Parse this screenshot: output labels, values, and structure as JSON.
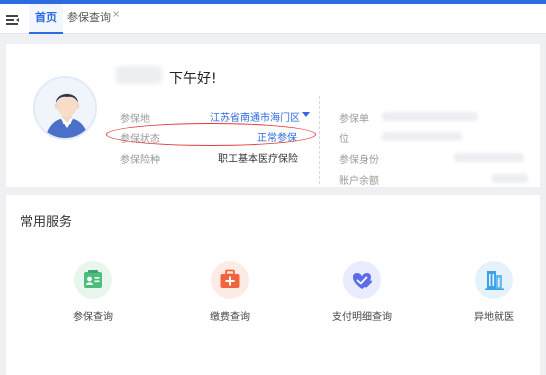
{
  "tabs": {
    "home": "首页",
    "insurance_query": "参保查询",
    "close_glyph": "×"
  },
  "profile": {
    "greeting": "下午好!",
    "insured_place_label": "参保地",
    "insured_place_value": "江苏省南通市海门区",
    "insured_status_label": "参保状态",
    "insured_status_value": "正常参保",
    "insurance_type_label": "参保险种",
    "insurance_type_value": "职工基本医疗保险",
    "insured_unit_label": "参保单",
    "position_label": "位",
    "insured_identity_label": "参保身份",
    "account_balance_label": "账户余额"
  },
  "services": {
    "title": "常用服务",
    "items": [
      {
        "label": "参保查询",
        "icon": "id-card-icon",
        "color": "#4cbd7b",
        "bg": "#e8f6ee"
      },
      {
        "label": "缴费查询",
        "icon": "medical-kit-icon",
        "color": "#f0643e",
        "bg": "#fdece6"
      },
      {
        "label": "支付明细查询",
        "icon": "heart-check-icon",
        "color": "#5b6ee8",
        "bg": "#e9ecfc"
      },
      {
        "label": "异地就医",
        "icon": "building-icon",
        "color": "#3aa2e6",
        "bg": "#e5f2fc"
      }
    ]
  },
  "colors": {
    "accent": "#2d6be0",
    "highlight_oval": "#e43a3a"
  }
}
